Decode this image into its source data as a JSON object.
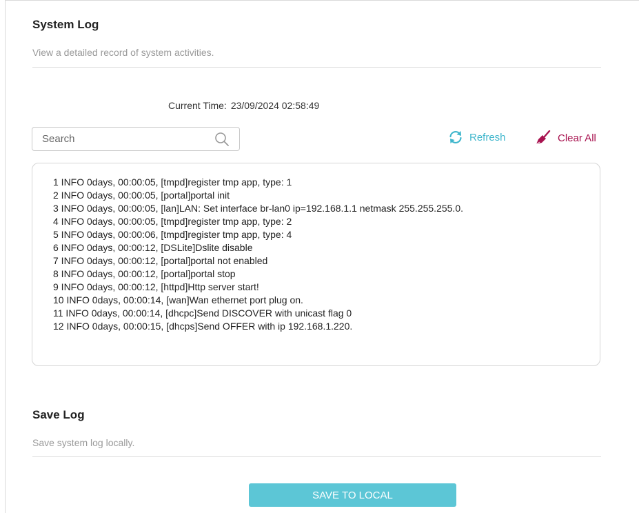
{
  "system_log": {
    "title": "System Log",
    "description": "View a detailed record of system activities.",
    "current_time_label": "Current Time:",
    "current_time_value": "23/09/2024 02:58:49",
    "search_placeholder": "Search",
    "refresh_label": "Refresh",
    "clear_all_label": "Clear All",
    "entries": [
      "1 INFO 0days, 00:00:05, [tmpd]register tmp app, type: 1",
      "2 INFO 0days, 00:00:05, [portal]portal init",
      "3 INFO 0days, 00:00:05, [lan]LAN: Set interface br-lan0 ip=192.168.1.1 netmask 255.255.255.0.",
      "4 INFO 0days, 00:00:05, [tmpd]register tmp app, type: 2",
      "5 INFO 0days, 00:00:06, [tmpd]register tmp app, type: 4",
      "6 INFO 0days, 00:00:12, [DSLite]Dslite disable",
      "7 INFO 0days, 00:00:12, [portal]portal not enabled",
      "8 INFO 0days, 00:00:12, [portal]portal stop",
      "9 INFO 0days, 00:00:12, [httpd]Http server start!",
      "10 INFO 0days, 00:00:14, [wan]Wan ethernet port plug on.",
      "11 INFO 0days, 00:00:14, [dhcpc]Send DISCOVER with unicast flag 0",
      "12 INFO 0days, 00:00:15, [dhcps]Send OFFER with ip 192.168.1.220."
    ]
  },
  "save_log": {
    "title": "Save Log",
    "description": "Save system log locally.",
    "button_label": "SAVE TO LOCAL"
  },
  "colors": {
    "accent": "#3fb6cc",
    "clear_all": "#a8124f",
    "save_button_bg": "#5cc6d6"
  },
  "icons": {
    "search": "search-icon",
    "refresh": "refresh-icon",
    "clear_all": "broom-icon"
  }
}
